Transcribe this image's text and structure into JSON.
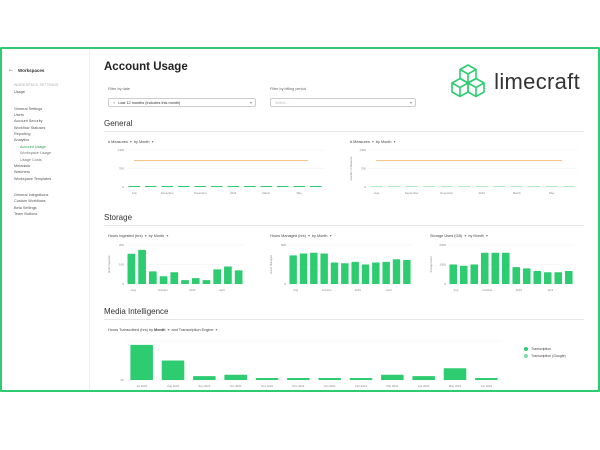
{
  "sidebar": {
    "back_label": "Workspaces",
    "section1_title": "WORKSPACE SETTINGS",
    "section1": [
      "Usage"
    ],
    "section2": [
      {
        "label": "General Settings",
        "type": "item"
      },
      {
        "label": "Users",
        "type": "item"
      },
      {
        "label": "Account Security",
        "type": "item"
      },
      {
        "label": "Workflow Statuses",
        "type": "item"
      },
      {
        "label": "Reporting",
        "type": "item"
      },
      {
        "label": "Analytics",
        "type": "item"
      },
      {
        "label": "Account Usage",
        "type": "sub-active"
      },
      {
        "label": "Workspace Usage",
        "type": "sub"
      },
      {
        "label": "Usage Costs",
        "type": "sub"
      },
      {
        "label": "Metadata",
        "type": "item"
      },
      {
        "label": "Watchers",
        "type": "item"
      },
      {
        "label": "Workspace Templates",
        "type": "item"
      }
    ],
    "section3": [
      "General Integrations",
      "Custom Workflows",
      "Beta Settings",
      "Team Buttons"
    ]
  },
  "header": {
    "title": "Account Usage",
    "filter_date_label": "Filter by date",
    "filter_date_value": "Last 12 months (includes this month)",
    "filter_period_label": "Filter by billing period",
    "filter_period_placeholder": "Select..."
  },
  "logo": {
    "text": "limecraft",
    "color": "#2ecc71"
  },
  "sections": {
    "general": "General",
    "storage": "Storage",
    "media": "Media Intelligence"
  },
  "colors": {
    "bar": "#2ecc71",
    "line": "#f0a040",
    "accent": "#2e9e5b"
  },
  "chart_data": [
    {
      "id": "general-1",
      "type": "bar",
      "header": {
        "metric": "# Measures",
        "by": "by",
        "dim": "Month"
      },
      "ylim": [
        0,
        1400
      ],
      "yticks": [
        "1400",
        "700",
        "0"
      ],
      "ylabel": "",
      "categories": [
        "Aug",
        "",
        "December",
        "",
        "November",
        "",
        "2024",
        "",
        "March",
        "",
        "May",
        ""
      ],
      "xlabels": [
        "July",
        "",
        "December",
        "",
        "November",
        "",
        "2024",
        "",
        "March",
        "",
        "May",
        ""
      ],
      "values": [
        40,
        40,
        40,
        40,
        40,
        40,
        40,
        40,
        40,
        40,
        40,
        40
      ],
      "line": 1000
    },
    {
      "id": "general-2",
      "type": "bar",
      "header": {
        "metric": "# Measures",
        "by": "by",
        "dim": "Month"
      },
      "ylim": [
        0,
        1400
      ],
      "yticks": [
        "1400",
        "700",
        "0"
      ],
      "ylabel": "Number of Measures",
      "xlabels": [
        "Aug",
        "",
        "September",
        "",
        "November",
        "",
        "2024",
        "",
        "March",
        "",
        "May",
        ""
      ],
      "values": [
        15,
        15,
        15,
        15,
        15,
        15,
        15,
        15,
        15,
        15,
        15,
        15
      ],
      "line": 1000
    },
    {
      "id": "storage-1",
      "type": "bar",
      "header": {
        "metric": "Hours Ingested (hrs)",
        "by": "by",
        "dim": "Month"
      },
      "ylim": [
        0,
        200
      ],
      "yticks": [
        "200",
        "100",
        "0"
      ],
      "ylabel": "Hours Ingested",
      "xlabels": [
        "Aug",
        "",
        "October",
        "",
        "2024",
        "",
        "April",
        ""
      ],
      "values": [
        155,
        175,
        65,
        40,
        60,
        20,
        30,
        20,
        75,
        90,
        70
      ]
    },
    {
      "id": "storage-2",
      "type": "bar",
      "header": {
        "metric": "Hours Managed (hrs)",
        "by": "by",
        "dim": "Month"
      },
      "ylim": [
        0,
        600
      ],
      "yticks": [
        "600",
        "",
        "0"
      ],
      "ylabel": "Hours Managed",
      "xlabels": [
        "Aug",
        "",
        "October",
        "",
        "2024",
        "",
        "April",
        ""
      ],
      "values": [
        440,
        470,
        480,
        470,
        330,
        320,
        340,
        300,
        330,
        340,
        380,
        370
      ]
    },
    {
      "id": "storage-3",
      "type": "bar",
      "header": {
        "metric": "Storage Used (GB)",
        "by": "by",
        "dim": "Month"
      },
      "ylim": [
        0,
        3000
      ],
      "yticks": [
        "2000",
        "1000",
        "0"
      ],
      "ylabel": "Storage Used",
      "xlabels": [
        "Aug",
        "",
        "October",
        "",
        "2024",
        "",
        "April",
        ""
      ],
      "values": [
        1500,
        1400,
        1500,
        2400,
        2400,
        2400,
        1300,
        1200,
        1000,
        900,
        900,
        1000
      ]
    },
    {
      "id": "media",
      "type": "bar",
      "header": {
        "metric": "Hours Transcribed (hrs)",
        "by": "by",
        "dim": "Month",
        "and": "and",
        "dim2": "Transcription Engine"
      },
      "ylim": [
        0,
        30
      ],
      "yticks": [
        "",
        "0h"
      ],
      "ylabel": "",
      "xlabels": [
        "Jul 2023",
        "Aug 2023",
        "Sep 2023",
        "Oct 2023",
        "Nov 2023",
        "Dec 2023",
        "Jan 2024",
        "Feb 2024",
        "Mar 2024",
        "Apr 2024",
        "May 2024",
        "Jun 2024"
      ],
      "values": [
        27,
        15,
        3,
        4,
        1.5,
        1.5,
        1.5,
        1.5,
        4,
        3,
        9,
        1.5
      ],
      "legend": [
        "Transcription",
        "Transcription (Google)"
      ]
    }
  ]
}
